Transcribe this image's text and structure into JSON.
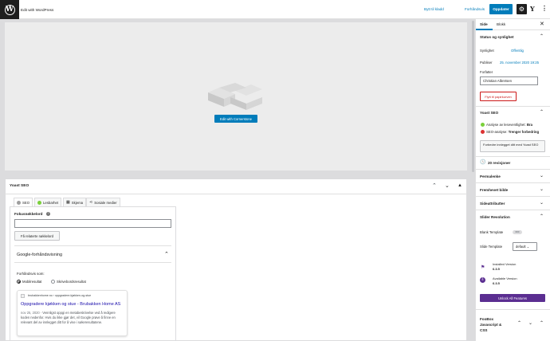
{
  "topbar": {
    "title": "Edit with WordPress",
    "save_draft": "Bytt til kladd",
    "preview": "Forhåndsvis",
    "update": "Oppdater"
  },
  "canvas": {
    "cornerstone_button": "Edit with Cornerstone"
  },
  "yoast_box": {
    "title": "Yoast SEO",
    "tabs": [
      "SEO",
      "Lesbarhet",
      "Skjema",
      "Sosiale medier"
    ],
    "focus_keyword_label": "Fokusnøkkelord",
    "focus_keyword_value": "",
    "related_button": "Få relaterte nøkkelord",
    "google_preview_title": "Google-forhåndsvisning",
    "preview_as": "Forhåndsvis som:",
    "radio_mobile": "Mobilresultat",
    "radio_desktop": "Skrivebordsresultat",
    "serp": {
      "url": "brubakkenhome.no › oppgradere-kjøkken-og-stue",
      "title": "Oppgradere kjøkken og stue - Brubakken Home AS",
      "date": "nov 25, 2020",
      "description": " ⋅ Vennligst oppgi en metabeskrivelse ved å redigere koden nedenfor. Hvis du ikke gjør det, vil Google prøve å finne en relevant del av innlegget ditt for å vise i søkeresultatene."
    }
  },
  "sidebar": {
    "tab_page": "Side",
    "tab_block": "Blokk",
    "status": {
      "title": "Status og synlighet",
      "visibility_label": "Synlighet",
      "visibility_value": "Offentlig",
      "publish_label": "Publiser",
      "publish_value": "25. november 2020 19:25",
      "author_label": "Forfatter",
      "author_value": "Christian Albretsen",
      "trash_button": "Flytt til papirkurven"
    },
    "yoast": {
      "title": "Yoast SEO",
      "readability": "Analyse av leseventlighet:",
      "readability_value": "Bra",
      "seo": "SEO-analyse:",
      "seo_value": "Trenger forbedring",
      "improve_button": "Forbedre innlegget ditt med Yoast SEO"
    },
    "revisions": "20 revisjoner",
    "permalink": "Permalenke",
    "featured_image": "Fremhevet bilde",
    "page_attributes": "Sideattributter",
    "slider": {
      "title": "Slider Revolution",
      "blank_template": "Blank Template",
      "toggle": "OFF",
      "slide_template": "Slide Template",
      "slide_template_value": "default",
      "installed_label": "Installed Version",
      "installed_value": "6.3.5",
      "available_label": "Available Version",
      "available_value": "6.3.5",
      "unlock_button": "Unlock All Features"
    },
    "foobox": {
      "line1": "FooBox",
      "line2": "Javascript &",
      "line3": "CSS"
    }
  },
  "colors": {
    "accent": "#007cba",
    "dark": "#1e1e1e",
    "danger": "#cc1818",
    "good": "#7ad03a",
    "bad": "#dc3232",
    "slider_purple": "#5b2e91"
  }
}
